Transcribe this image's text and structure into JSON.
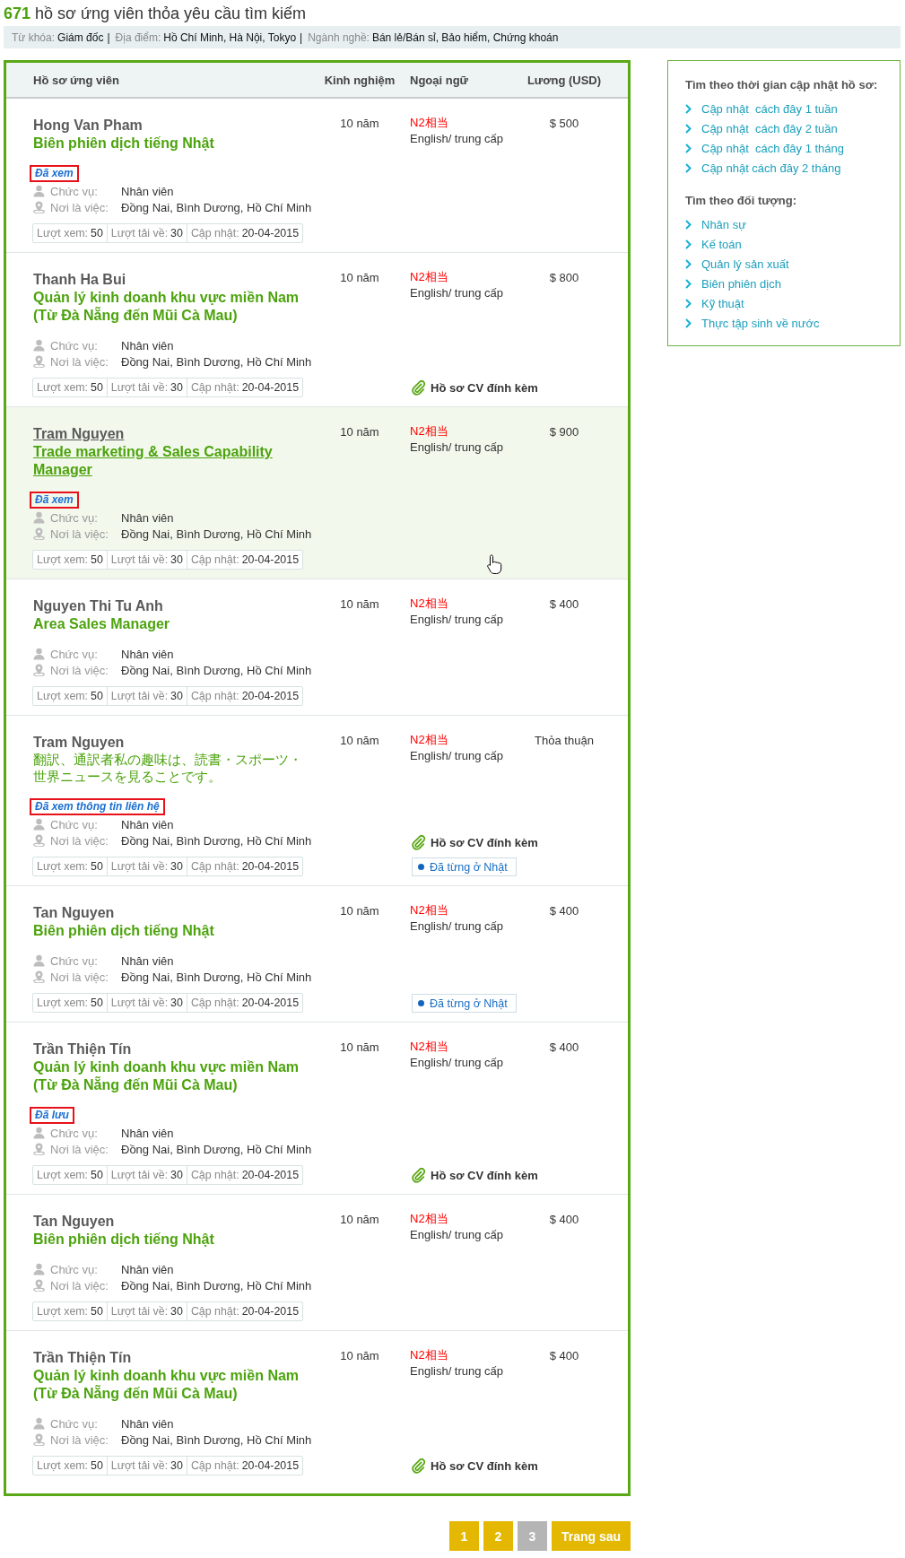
{
  "heading": "**671** hồ sơ ứng viên thỏa yêu cầu tìm kiếm",
  "filter_bar": {
    "separator": "|",
    "filters": [
      {
        "label": "Từ khóa:",
        "value": "Giám đốc"
      },
      {
        "label": "Địa điểm:",
        "value": "Hồ Chí Minh, Hà Nội, Tokyo"
      },
      {
        "label": "Ngành nghề:",
        "value": "Bán lẻ/Bán sỉ, Bảo hiểm, Chứng khoán"
      }
    ]
  },
  "table": {
    "columns": [
      "Hồ sơ ứng viên",
      "Kinh nghiệm",
      "Ngoại ngữ",
      "Lương (USD)"
    ],
    "rows": [
      {
        "name": "Hong Van Pham",
        "title": {
          "kind": "latin",
          "text": "Biên phiên dịch tiếng Nhật"
        },
        "tag": "Đã xem",
        "details": [
          {
            "kind": "position",
            "label": "Chức vụ:",
            "value": "Nhân viên"
          },
          {
            "kind": "location",
            "label": "Nơi là việc:",
            "value": "Đồng Nai, Bình Dương, Hồ Chí Minh"
          }
        ],
        "stats": [
          {
            "label": "Lượt xem:",
            "value": "50"
          },
          {
            "label": "Lượt tải về:",
            "value": "30"
          },
          {
            "label": "Cập nhật:",
            "value": "20-04-2015"
          }
        ],
        "experience": "10 năm",
        "japanese_level": "N2相当",
        "english_level": "English/ trung cấp",
        "salary": "$ 500",
        "hovered": false
      },
      {
        "name": "Thanh Ha Bui",
        "title": {
          "kind": "latin",
          "text": "Quản lý kinh doanh khu vực miền Nam (Từ Đà Nẵng đến Mũi Cà Mau)"
        },
        "details": [
          {
            "kind": "position",
            "label": "Chức vụ:",
            "value": "Nhân viên"
          },
          {
            "kind": "location",
            "label": "Nơi là việc:",
            "value": "Đồng Nai, Bình Dương, Hồ Chí Minh"
          }
        ],
        "stats": [
          {
            "label": "Lượt xem:",
            "value": "50"
          },
          {
            "label": "Lượt tải về:",
            "value": "30"
          },
          {
            "label": "Cập nhật:",
            "value": "20-04-2015"
          }
        ],
        "experience": "10 năm",
        "japanese_level": "N2相当",
        "english_level": "English/ trung cấp",
        "salary": "$ 800",
        "attachment": "Hồ sơ CV đính kèm",
        "hovered": false
      },
      {
        "name": "Tram Nguyen",
        "title": {
          "kind": "latin",
          "text": "Trade marketing & Sales Capability Manager"
        },
        "tag": "Đã xem",
        "details": [
          {
            "kind": "position",
            "label": "Chức vụ:",
            "value": "Nhân viên"
          },
          {
            "kind": "location",
            "label": "Nơi là việc:",
            "value": "Đồng Nai, Bình Dương, Hồ Chí Minh"
          }
        ],
        "stats": [
          {
            "label": "Lượt xem:",
            "value": "50"
          },
          {
            "label": "Lượt tải về:",
            "value": "30"
          },
          {
            "label": "Cập nhật:",
            "value": "20-04-2015"
          }
        ],
        "experience": "10 năm",
        "japanese_level": "N2相当",
        "english_level": "English/ trung cấp",
        "salary": "$ 900",
        "hovered": true
      },
      {
        "name": "Nguyen Thi Tu Anh",
        "title": {
          "kind": "latin",
          "text": "Area Sales Manager"
        },
        "details": [
          {
            "kind": "position",
            "label": "Chức vụ:",
            "value": "Nhân viên"
          },
          {
            "kind": "location",
            "label": "Nơi là việc:",
            "value": "Đồng Nai, Bình Dương, Hồ Chí Minh"
          }
        ],
        "stats": [
          {
            "label": "Lượt xem:",
            "value": "50"
          },
          {
            "label": "Lượt tải về:",
            "value": "30"
          },
          {
            "label": "Cập nhật:",
            "value": "20-04-2015"
          }
        ],
        "experience": "10 năm",
        "japanese_level": "N2相当",
        "english_level": "English/ trung cấp",
        "salary": "$ 400",
        "hovered": false
      },
      {
        "name": "Tram Nguyen",
        "title": {
          "kind": "cjk",
          "text": "翻訳、通訳者私の趣味は、読書・スポーツ・世界ニュースを見ることです。"
        },
        "tag": "Đã xem thông tin liên hệ",
        "details": [
          {
            "kind": "position",
            "label": "Chức vụ:",
            "value": "Nhân viên"
          },
          {
            "kind": "location",
            "label": "Nơi là việc:",
            "value": "Đồng Nai, Bình Dương, Hồ Chí Minh"
          }
        ],
        "stats": [
          {
            "label": "Lượt xem:",
            "value": "50"
          },
          {
            "label": "Lượt tải về:",
            "value": "30"
          },
          {
            "label": "Cập nhật:",
            "value": "20-04-2015"
          }
        ],
        "experience": "10 năm",
        "japanese_level": "N2相当",
        "english_level": "English/ trung cấp",
        "salary": "Thỏa thuận",
        "attachment": "Hồ sơ CV đính kèm",
        "badge": "Đã từng ở Nhật",
        "hovered": false
      },
      {
        "name": "Tan Nguyen",
        "title": {
          "kind": "latin",
          "text": "Biên phiên dịch tiếng Nhật"
        },
        "details": [
          {
            "kind": "position",
            "label": "Chức vụ:",
            "value": "Nhân viên"
          },
          {
            "kind": "location",
            "label": "Nơi là việc:",
            "value": "Đồng Nai, Bình Dương, Hồ Chí Minh"
          }
        ],
        "stats": [
          {
            "label": "Lượt xem:",
            "value": "50"
          },
          {
            "label": "Lượt tải về:",
            "value": "30"
          },
          {
            "label": "Cập nhật:",
            "value": "20-04-2015"
          }
        ],
        "experience": "10 năm",
        "japanese_level": "N2相当",
        "english_level": "English/ trung cấp",
        "salary": "$ 400",
        "badge": "Đã từng ở Nhật",
        "hovered": false
      },
      {
        "name": "Trần Thiện Tín",
        "title": {
          "kind": "latin",
          "text": "Quản lý kinh doanh khu vực miền Nam (Từ Đà Nẵng đến Mũi Cà Mau)"
        },
        "tag": "Đã lưu",
        "details": [
          {
            "kind": "position",
            "label": "Chức vụ:",
            "value": "Nhân viên"
          },
          {
            "kind": "location",
            "label": "Nơi là việc:",
            "value": "Đồng Nai, Bình Dương, Hồ Chí Minh"
          }
        ],
        "stats": [
          {
            "label": "Lượt xem:",
            "value": "50"
          },
          {
            "label": "Lượt tải về:",
            "value": "30"
          },
          {
            "label": "Cập nhật:",
            "value": "20-04-2015"
          }
        ],
        "experience": "10 năm",
        "japanese_level": "N2相当",
        "english_level": "English/ trung cấp",
        "salary": "$ 400",
        "attachment": "Hồ sơ CV đính kèm",
        "hovered": false
      },
      {
        "name": "Tan Nguyen",
        "title": {
          "kind": "latin",
          "text": "Biên phiên dịch tiếng Nhật"
        },
        "details": [
          {
            "kind": "position",
            "label": "Chức vụ:",
            "value": "Nhân viên"
          },
          {
            "kind": "location",
            "label": "Nơi là việc:",
            "value": "Đồng Nai, Bình Dương, Hồ Chí Minh"
          }
        ],
        "stats": [
          {
            "label": "Lượt xem:",
            "value": "50"
          },
          {
            "label": "Lượt tải về:",
            "value": "30"
          },
          {
            "label": "Cập nhật:",
            "value": "20-04-2015"
          }
        ],
        "experience": "10 năm",
        "japanese_level": "N2相当",
        "english_level": "English/ trung cấp",
        "salary": "$ 400",
        "hovered": false
      },
      {
        "name": "Trần Thiện Tín",
        "title": {
          "kind": "latin",
          "text": "Quản lý kinh doanh khu vực miền Nam (Từ Đà Nẵng đến Mũi Cà Mau)"
        },
        "details": [
          {
            "kind": "position",
            "label": "Chức vụ:",
            "value": "Nhân viên"
          },
          {
            "kind": "location",
            "label": "Nơi là việc:",
            "value": "Đồng Nai, Bình Dương, Hồ Chí Minh"
          }
        ],
        "stats": [
          {
            "label": "Lượt xem:",
            "value": "50"
          },
          {
            "label": "Lượt tải về:",
            "value": "30"
          },
          {
            "label": "Cập nhật:",
            "value": "20-04-2015"
          }
        ],
        "experience": "10 năm",
        "japanese_level": "N2相当",
        "english_level": "English/ trung cấp",
        "salary": "$ 400",
        "attachment": "Hồ sơ CV đính kèm",
        "hovered": false
      }
    ]
  },
  "pagination": {
    "pages": [
      {
        "label": "1",
        "selected": false
      },
      {
        "label": "2",
        "selected": false
      },
      {
        "label": "3",
        "selected": true
      }
    ],
    "next": "Trang sau"
  },
  "sidebar": {
    "sections": [
      {
        "heading": "Tìm theo thời gian cập nhật hồ sơ:",
        "links": [
          "Cập nhật  cách đây 1 tuần",
          "Cập nhật  cách đây 2 tuần",
          "Cập nhật  cách đây 1 tháng",
          "Cập nhật cách đây 2 tháng"
        ]
      },
      {
        "heading": "Tìm theo đối tượng:",
        "links": [
          "Nhân sự",
          "Kế toán",
          "Quản lý sản xuất",
          "Biên phiên dịch",
          "Kỹ thuật",
          "Thực tập sinh về nước"
        ]
      }
    ]
  }
}
